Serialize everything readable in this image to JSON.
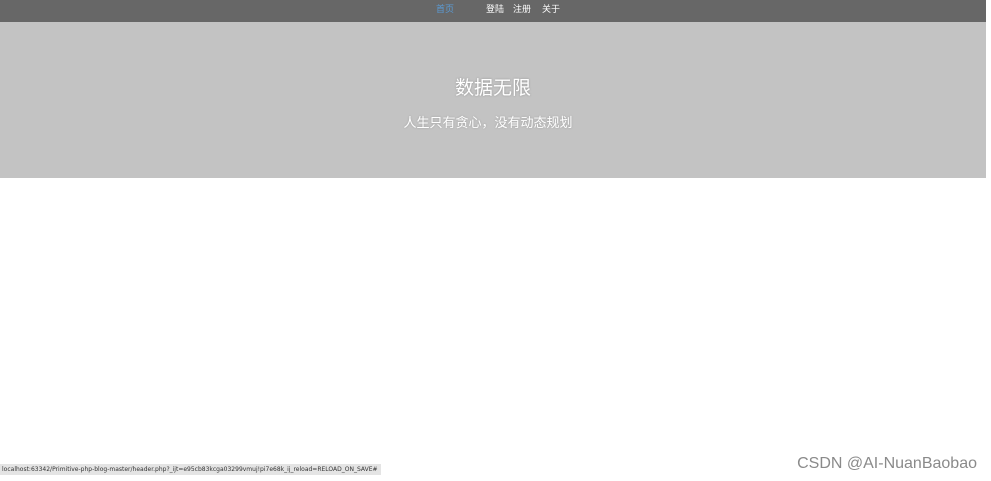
{
  "nav": {
    "items": [
      {
        "label": "首页",
        "active": true
      },
      {
        "label": "登陆",
        "active": false
      },
      {
        "label": "注册",
        "active": false
      },
      {
        "label": "关于",
        "active": false
      }
    ],
    "active_color": "#5b9bd5",
    "bar_color": "#676767"
  },
  "hero": {
    "title": "数据无限",
    "subtitle": "人生只有贪心，没有动态规划",
    "background": "#c3c3c3"
  },
  "status_bar": {
    "url": "localhost:63342/Primitive-php-blog-master/header.php?_ijt=e95cb83kcga03299vmuj!pi7e68k_ij_reload=RELOAD_ON_SAVE#"
  },
  "watermark": {
    "text": "CSDN @AI-NuanBaobao"
  }
}
